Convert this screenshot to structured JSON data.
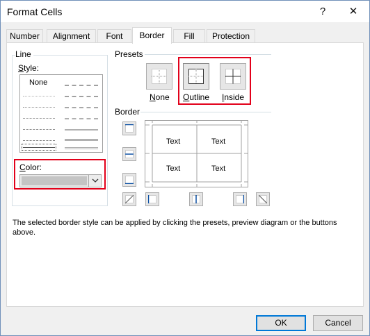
{
  "window": {
    "title": "Format Cells",
    "help_glyph": "?",
    "close_glyph": "✕"
  },
  "tabs": [
    "Number",
    "Alignment",
    "Font",
    "Border",
    "Fill",
    "Protection"
  ],
  "active_tab": "Border",
  "line_group": {
    "label": "Line",
    "style_label": "Style:",
    "style_none": "None",
    "color_label": "Color:",
    "color_value": "#c4c4c4"
  },
  "presets": {
    "label": "Presets",
    "items": [
      {
        "key": "N",
        "rest": "one"
      },
      {
        "key": "O",
        "rest": "utline"
      },
      {
        "key": "I",
        "rest": "nside"
      }
    ]
  },
  "border_group": {
    "label": "Border",
    "preview_cells": [
      "Text",
      "Text",
      "Text",
      "Text"
    ]
  },
  "description": "The selected border style can be applied by clicking the presets, preview diagram or the buttons above.",
  "buttons": {
    "ok": "OK",
    "cancel": "Cancel"
  },
  "highlight_color": "#e2001a"
}
